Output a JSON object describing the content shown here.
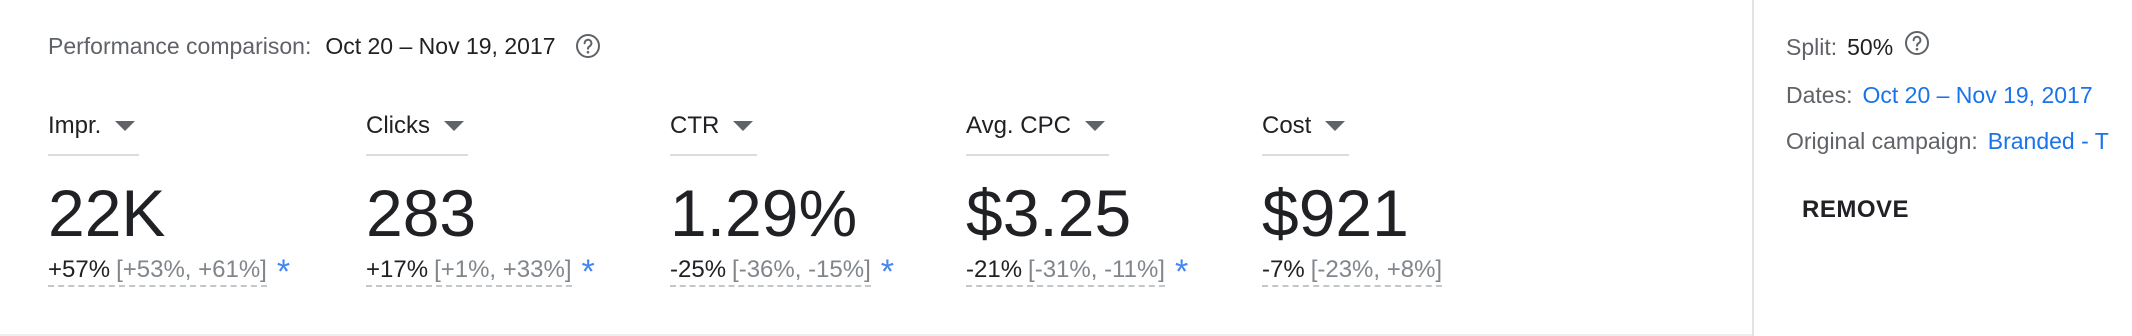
{
  "header": {
    "label": "Performance comparison:",
    "date_range": "Oct 20 – Nov 19, 2017",
    "help_icon": "help-circle-icon"
  },
  "metrics": [
    {
      "name": "Impr.",
      "value": "22K",
      "change": "+57%",
      "interval": "[+53%, +61%]",
      "significant": true
    },
    {
      "name": "Clicks",
      "value": "283",
      "change": "+17%",
      "interval": "[+1%, +33%]",
      "significant": true
    },
    {
      "name": "CTR",
      "value": "1.29%",
      "change": "-25%",
      "interval": "[-36%, -15%]",
      "significant": true
    },
    {
      "name": "Avg. CPC",
      "value": "$3.25",
      "change": "-21%",
      "interval": "[-31%, -11%]",
      "significant": true
    },
    {
      "name": "Cost",
      "value": "$921",
      "change": "-7%",
      "interval": "[-23%, +8%]",
      "significant": false
    }
  ],
  "significance_marker": "*",
  "side": {
    "split_label": "Split:",
    "split_value": "50%",
    "dates_label": "Dates:",
    "dates_value": "Oct 20 – Nov 19, 2017",
    "original_label": "Original campaign:",
    "original_value": "Branded - T",
    "remove_label": "REMOVE"
  },
  "colors": {
    "accent": "#1a73e8",
    "star": "#4285f4",
    "text": "#202124",
    "muted": "#5f6368"
  }
}
